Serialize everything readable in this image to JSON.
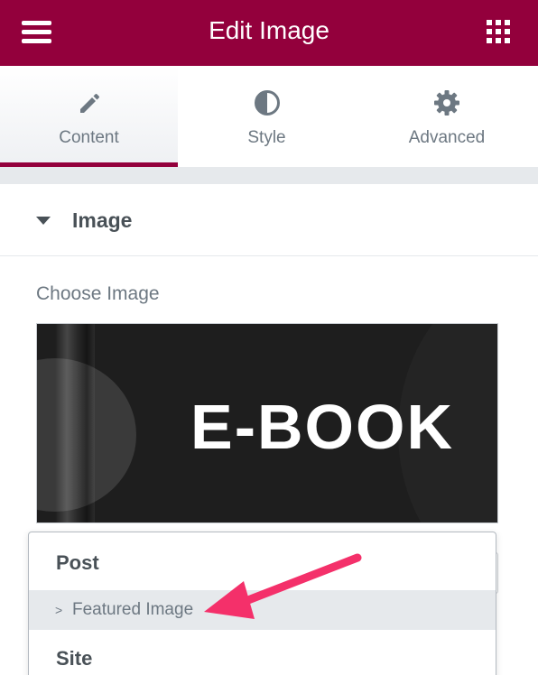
{
  "header": {
    "title": "Edit Image",
    "menu_icon": "hamburger-menu-icon",
    "apps_icon": "grid-apps-icon",
    "color": "#93003c"
  },
  "tabs": [
    {
      "label": "Content",
      "icon": "pencil-icon",
      "active": true
    },
    {
      "label": "Style",
      "icon": "half-circle-contrast-icon",
      "active": false
    },
    {
      "label": "Advanced",
      "icon": "gear-icon",
      "active": false
    }
  ],
  "section": {
    "title": "Image",
    "toggle_icon": "caret-down-icon"
  },
  "control": {
    "label": "Choose Image",
    "preview_text": "E-BOOK"
  },
  "dropdown": {
    "groups": [
      {
        "label": "Post",
        "items": [
          {
            "chevron": ">",
            "label": "Featured Image"
          }
        ]
      },
      {
        "label": "Site"
      }
    ],
    "highlighted_item": "Featured Image"
  },
  "annotation": {
    "arrow_color": "#f4306a"
  }
}
